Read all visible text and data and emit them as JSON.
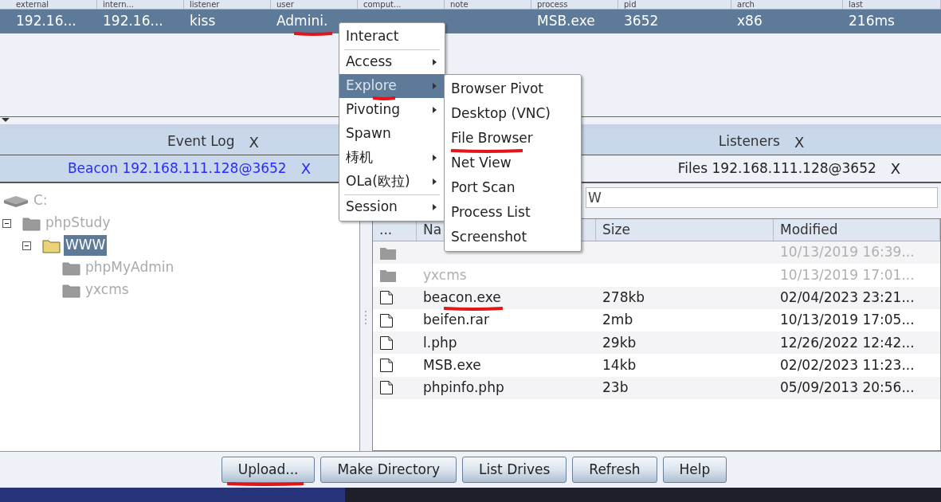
{
  "sessions": {
    "columns": [
      "external",
      "intern...",
      "listener",
      "user",
      "comput...",
      "note",
      "process",
      "pid",
      "arch",
      "last"
    ],
    "rows": [
      {
        "selected": true,
        "cells": [
          {
            "text": "192.16...",
            "marked": false
          },
          {
            "text": "192.16...",
            "marked": false
          },
          {
            "text": "kiss",
            "marked": false
          },
          {
            "text": "Admini.",
            "marked": true
          },
          {
            "marked": false
          },
          {
            "marked": false
          },
          {
            "text": "MSB.exe",
            "marked": false
          },
          {
            "text": "3652",
            "marked": false
          },
          {
            "text": "x86",
            "marked": false
          },
          {
            "text": "216ms",
            "marked": false
          }
        ]
      }
    ]
  },
  "tab_rows": [
    [
      {
        "label": "Event Log",
        "close": "X",
        "selected": false
      },
      {
        "label": "Listeners",
        "close": "X",
        "selected": false
      }
    ],
    [
      {
        "label": "Beacon 192.168.111.128@3652",
        "close": "X",
        "selected": true
      },
      {
        "label": "Files 192.168.111.128@3652",
        "close": "X",
        "selected": false
      }
    ]
  ],
  "tree": [
    {
      "label": "C:",
      "kind": "drive",
      "selected": false,
      "children": [
        {
          "label": "phpStudy",
          "kind": "folder",
          "expanded": true,
          "selected": false,
          "children": [
            {
              "label": "WWW",
              "kind": "folder",
              "expanded": true,
              "selected": true,
              "children": [
                {
                  "label": "phpMyAdmin",
                  "kind": "folder",
                  "selected": false
                },
                {
                  "label": "yxcms",
                  "kind": "folder",
                  "selected": false
                }
              ]
            }
          ]
        }
      ]
    }
  ],
  "path_field": {
    "value": "W"
  },
  "files": {
    "columns": [
      "...",
      "Na",
      "Size",
      "Modified"
    ],
    "rows": [
      {
        "kind": "folder",
        "modified": "10/13/2019 16:39...",
        "marked": false
      },
      {
        "kind": "folder",
        "name": "yxcms",
        "modified": "10/13/2019 17:01...",
        "marked": false
      },
      {
        "kind": "file",
        "name": "beacon.exe",
        "size": "278kb",
        "modified": "02/04/2023 23:21...",
        "marked": true
      },
      {
        "kind": "file",
        "name": "beifen.rar",
        "size": "2mb",
        "modified": "10/13/2019 17:05...",
        "marked": false
      },
      {
        "kind": "file",
        "name": "l.php",
        "size": "29kb",
        "modified": "12/26/2022 12:42...",
        "marked": false
      },
      {
        "kind": "file",
        "name": "MSB.exe",
        "size": "14kb",
        "modified": "02/02/2023 11:23...",
        "marked": false
      },
      {
        "kind": "file",
        "name": "phpinfo.php",
        "size": "23b",
        "modified": "05/09/2013 20:56...",
        "marked": false
      }
    ]
  },
  "buttons": [
    {
      "label": "Upload...",
      "marked": true
    },
    {
      "label": "Make Directory",
      "marked": false
    },
    {
      "label": "List Drives",
      "marked": false
    },
    {
      "label": "Refresh",
      "marked": false
    },
    {
      "label": "Help",
      "marked": false
    }
  ],
  "context_menu": {
    "items": [
      {
        "kind": "item",
        "label": "Interact",
        "submenu": false,
        "selected": false,
        "marked": false
      },
      {
        "kind": "separator"
      },
      {
        "kind": "item",
        "label": "Access",
        "submenu": true,
        "selected": false,
        "marked": false
      },
      {
        "kind": "item",
        "label": "Explore",
        "submenu": true,
        "selected": true,
        "marked": true
      },
      {
        "kind": "item",
        "label": "Pivoting",
        "submenu": true,
        "selected": false,
        "marked": false
      },
      {
        "kind": "item",
        "label": "Spawn",
        "submenu": false,
        "selected": false,
        "marked": false
      },
      {
        "kind": "item",
        "label": "梼机",
        "submenu": true,
        "selected": false,
        "marked": false
      },
      {
        "kind": "item",
        "label": "OLa(欧拉)",
        "submenu": true,
        "selected": false,
        "marked": false
      },
      {
        "kind": "separator"
      },
      {
        "kind": "item",
        "label": "Session",
        "submenu": true,
        "selected": false,
        "marked": false
      }
    ]
  },
  "submenu": {
    "items": [
      {
        "label": "Browser Pivot",
        "marked": false
      },
      {
        "label": "Desktop (VNC)",
        "marked": false
      },
      {
        "label": "File Browser",
        "marked": true
      },
      {
        "label": "Net View",
        "marked": false
      },
      {
        "label": "Port Scan",
        "marked": false
      },
      {
        "label": "Process List",
        "marked": false
      },
      {
        "label": "Screenshot",
        "marked": false
      }
    ]
  }
}
